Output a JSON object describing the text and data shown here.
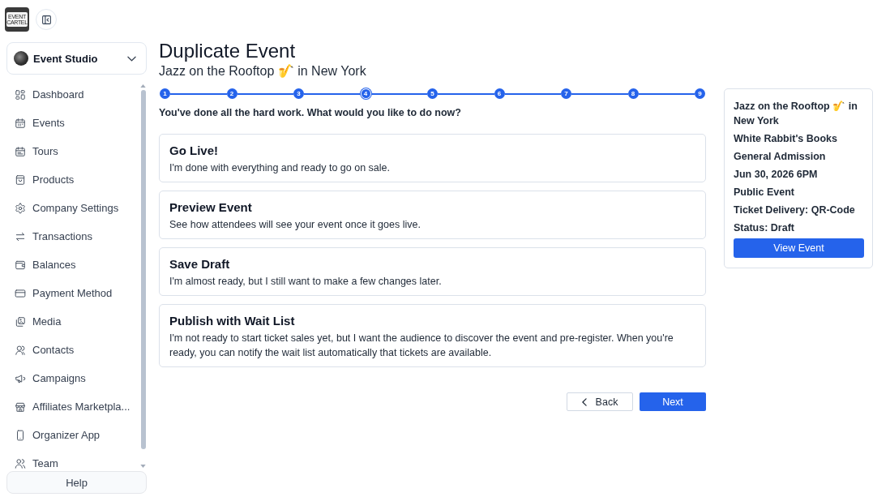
{
  "logo": {
    "lines": [
      "EVENT",
      "CARTEL"
    ]
  },
  "sidebar": {
    "workspace": "Event Studio",
    "items": [
      {
        "label": "Dashboard"
      },
      {
        "label": "Events"
      },
      {
        "label": "Tours"
      },
      {
        "label": "Products"
      },
      {
        "label": "Company Settings"
      },
      {
        "label": "Transactions"
      },
      {
        "label": "Balances"
      },
      {
        "label": "Payment Method"
      },
      {
        "label": "Media"
      },
      {
        "label": "Contacts"
      },
      {
        "label": "Campaigns"
      },
      {
        "label": "Affiliates Marketpla..."
      },
      {
        "label": "Organizer App"
      },
      {
        "label": "Team"
      }
    ],
    "help": "Help"
  },
  "page": {
    "title": "Duplicate Event",
    "subtitle": "Jazz on the Rooftop 🎷 in New York"
  },
  "steps": [
    {
      "label": "1",
      "selected": false
    },
    {
      "label": "2",
      "selected": false
    },
    {
      "label": "3",
      "selected": false
    },
    {
      "label": "4",
      "selected": true
    },
    {
      "label": "5",
      "selected": false
    },
    {
      "label": "6",
      "selected": false
    },
    {
      "label": "7",
      "selected": false
    },
    {
      "label": "8",
      "selected": false
    },
    {
      "label": "9",
      "selected": false
    }
  ],
  "prompt": "You've done all the hard work. What would you like to do now?",
  "options": [
    {
      "title": "Go Live!",
      "description": "I'm done with everything and ready to go on sale."
    },
    {
      "title": "Preview Event",
      "description": "See how attendees will see your event once it goes live."
    },
    {
      "title": "Save Draft",
      "description": "I'm almost ready, but I still want to make a few changes later."
    },
    {
      "title": "Publish with Wait List",
      "description": "I'm not ready to start ticket sales yet, but I want the audience to discover the event and pre-register. When you're ready, you can notify the wait list automatically that tickets are available."
    }
  ],
  "actions": {
    "back": "Back",
    "next": "Next"
  },
  "summary": {
    "lines": [
      "Jazz on the Rooftop 🎷 in New York",
      "White Rabbit's Books",
      "General Admission",
      "Jun 30, 2026 6PM",
      "Public Event",
      "Ticket Delivery: QR-Code",
      "Status: Draft"
    ],
    "button": "View Event"
  }
}
